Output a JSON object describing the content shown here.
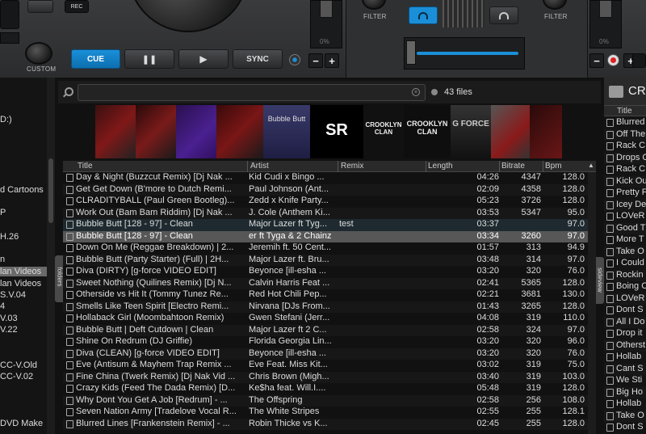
{
  "deck": {
    "rec_label": "REC",
    "custom_label": "CUSTOM",
    "cue_label": "CUE",
    "pause_label": "❚❚",
    "play_label": "▶",
    "sync_label": "SYNC",
    "filter_left_label": "FILTER",
    "filter_right_label": "FILTER",
    "minus_label": "−",
    "plus_label": "+",
    "pitch_value": "0%",
    "accent_color": "#1a8fd8"
  },
  "tree": {
    "items": [
      {
        "label": "D:)"
      },
      {
        "label": "d Cartoons"
      },
      {
        "label": "P"
      },
      {
        "label": "H.26"
      },
      {
        "label": "n"
      },
      {
        "label": "lan Videos"
      },
      {
        "label": "lan Videos"
      },
      {
        "label": "S.V.04"
      },
      {
        "label": "4"
      },
      {
        "label": "V.03"
      },
      {
        "label": "V.22"
      },
      {
        "label": "CC-V.Old"
      },
      {
        "label": "CC-V.02"
      },
      {
        "label": "DVD Make"
      }
    ],
    "folders_tab": "folders"
  },
  "search": {
    "placeholder": "",
    "value": "",
    "clear_icon": "×",
    "files_count": "43 files"
  },
  "covers": [
    {
      "text": ""
    },
    {
      "text": ""
    },
    {
      "text": ""
    },
    {
      "text": ""
    },
    {
      "text": "Bubble Butt"
    },
    {
      "text": "SR"
    },
    {
      "text": "CROOKLYN CLAN"
    },
    {
      "text": "CROOKLYN CLAN"
    },
    {
      "text": "G FORCE"
    },
    {
      "text": ""
    }
  ],
  "table": {
    "headers": {
      "title": "Title",
      "artist": "Artist",
      "remix": "Remix",
      "length": "Length",
      "bitrate": "Bitrate",
      "bpm": "Bpm"
    },
    "rows": [
      {
        "title": "Day & Night (Buzzcut Remix) [Dj Nak ...",
        "artist": "Kid Cudi x Bingo ...",
        "remix": "",
        "length": "04:26",
        "bitrate": "4347",
        "bpm": "128.0"
      },
      {
        "title": "Get Get Down (B'more to Dutch Remi...",
        "artist": "Paul Johnson (Ant...",
        "remix": "",
        "length": "02:09",
        "bitrate": "4358",
        "bpm": "128.0"
      },
      {
        "title": "CLRADITYBALL (Paul Green Bootleg)...",
        "artist": "Zedd x Knife Party...",
        "remix": "",
        "length": "05:23",
        "bitrate": "3726",
        "bpm": "128.0"
      },
      {
        "title": "Work Out (Bam Bam Riddim) [Dj Nak ...",
        "artist": "J. Cole (Anthem Ki...",
        "remix": "",
        "length": "03:53",
        "bitrate": "5347",
        "bpm": "95.0"
      },
      {
        "title": "Bubble Butt [128 - 97] - Clean",
        "artist": "Major Lazer ft Tyg...",
        "remix": "test",
        "length": "03:37",
        "bitrate": "",
        "bpm": "97.0"
      },
      {
        "title": "Bubble Butt [128 - 97] - Clean",
        "artist": "er ft Tyga & 2 Chainz",
        "remix": "",
        "length": "03:34",
        "bitrate": "3260",
        "bpm": "97.0"
      },
      {
        "title": "Down On Me (Reggae Breakdown) | 2...",
        "artist": "Jeremih ft. 50 Cent...",
        "remix": "",
        "length": "01:57",
        "bitrate": "313",
        "bpm": "94.9"
      },
      {
        "title": "Bubble Butt (Party Starter) (Full) | 2H...",
        "artist": "Major Lazer ft. Bru...",
        "remix": "",
        "length": "03:48",
        "bitrate": "314",
        "bpm": "97.0"
      },
      {
        "title": "Diva (DIRTY) [g-force VIDEO EDIT]",
        "artist": "Beyonce [ill-esha ...",
        "remix": "",
        "length": "03:20",
        "bitrate": "320",
        "bpm": "76.0"
      },
      {
        "title": "Sweet Nothing (Quilines Remix) [Dj N...",
        "artist": "Calvin Harris Feat ...",
        "remix": "",
        "length": "02:41",
        "bitrate": "5365",
        "bpm": "128.0"
      },
      {
        "title": "Otherside vs Hit It (Tommy Tunez Re...",
        "artist": "Red Hot Chili Pep...",
        "remix": "",
        "length": "02:21",
        "bitrate": "3681",
        "bpm": "130.0"
      },
      {
        "title": "Smells Like Teen Spirit [Electro Remi...",
        "artist": "Nirvana [DJs From...",
        "remix": "",
        "length": "01:43",
        "bitrate": "3265",
        "bpm": "128.0"
      },
      {
        "title": "Hollaback Girl (Moombahtoon Remix)",
        "artist": "Gwen Stefani (Jerr...",
        "remix": "",
        "length": "04:08",
        "bitrate": "319",
        "bpm": "110.0"
      },
      {
        "title": "Bubble Butt | Deft Cutdown | Clean",
        "artist": "Major Lazer ft 2 C...",
        "remix": "",
        "length": "02:58",
        "bitrate": "324",
        "bpm": "97.0"
      },
      {
        "title": "Shine On Redrum (DJ Griffie)",
        "artist": "Florida Georgia Lin...",
        "remix": "",
        "length": "03:20",
        "bitrate": "320",
        "bpm": "96.0"
      },
      {
        "title": "Diva (CLEAN) [g-force VIDEO EDIT]",
        "artist": "Beyonce [ill-esha ...",
        "remix": "",
        "length": "03:20",
        "bitrate": "320",
        "bpm": "76.0"
      },
      {
        "title": "Eve (Antisum & Mayhem Trap Remix ...",
        "artist": "Eve Feat. Miss Kit...",
        "remix": "",
        "length": "03:02",
        "bitrate": "319",
        "bpm": "75.0"
      },
      {
        "title": "Fine China (Twerk Remix) [Dj Nak Vid ...",
        "artist": "Chris Brown (Migh...",
        "remix": "",
        "length": "03:40",
        "bitrate": "319",
        "bpm": "103.0"
      },
      {
        "title": "Crazy Kids (Feed The Dada Remix) [D...",
        "artist": "Ke$ha feat. Will.I....",
        "remix": "",
        "length": "05:48",
        "bitrate": "319",
        "bpm": "128.0"
      },
      {
        "title": "Why Dont You Get A Job [Redrum] - ...",
        "artist": "The Offspring",
        "remix": "",
        "length": "02:58",
        "bitrate": "256",
        "bpm": "108.0"
      },
      {
        "title": "Seven Nation Army [Tradelove Vocal R...",
        "artist": "The White Stripes",
        "remix": "",
        "length": "02:55",
        "bitrate": "255",
        "bpm": "128.1"
      },
      {
        "title": "Blurred Lines [Frankenstein Remix] - ...",
        "artist": "Robin Thicke vs K...",
        "remix": "",
        "length": "02:45",
        "bitrate": "255",
        "bpm": "128.0"
      }
    ],
    "sideview_tab": "sideview"
  },
  "right_panel": {
    "title": "CR",
    "col_header": "Title",
    "items": [
      "Blurred",
      "Off The",
      "Rack C",
      "Drops C",
      "Rack C",
      "Kick Ou",
      "Pretty F",
      "Icey De",
      "LOVeR",
      "Good T",
      "More T",
      "Take O",
      "I Could",
      "Rockin",
      "Boing C",
      "LOVeR",
      "Dont S",
      "All I Do",
      "Drop it",
      "Otherst",
      "Hollab",
      "Cant S",
      "We Sti",
      "Big Ho",
      "Hollab",
      "Take O",
      "Dont S"
    ]
  }
}
